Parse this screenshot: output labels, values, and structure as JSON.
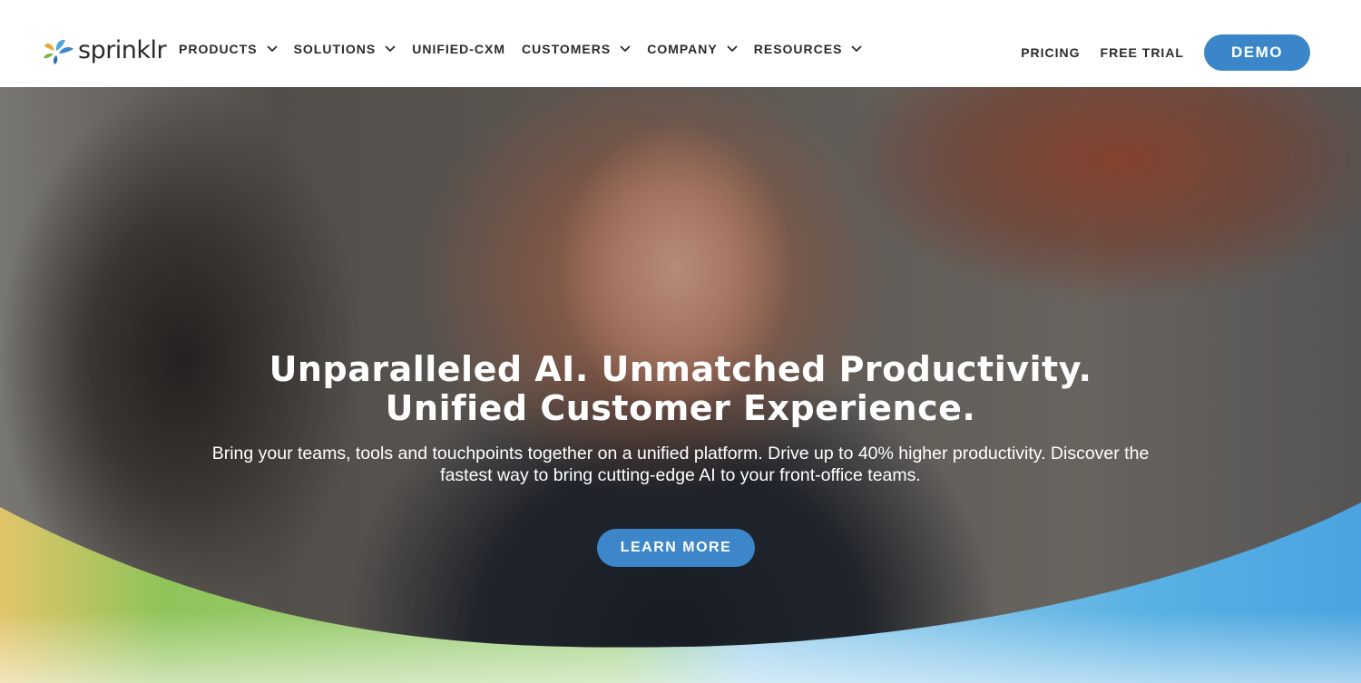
{
  "brand": {
    "name": "sprinklr",
    "accent": "#3b86c8"
  },
  "nav": {
    "items": [
      {
        "label": "PRODUCTS",
        "has_dropdown": true
      },
      {
        "label": "SOLUTIONS",
        "has_dropdown": true
      },
      {
        "label": "UNIFIED-CXM",
        "has_dropdown": false
      },
      {
        "label": "CUSTOMERS",
        "has_dropdown": true
      },
      {
        "label": "COMPANY",
        "has_dropdown": true
      },
      {
        "label": "RESOURCES",
        "has_dropdown": true
      }
    ],
    "right": {
      "pricing": "PRICING",
      "free_trial": "FREE TRIAL",
      "demo": "DEMO"
    }
  },
  "hero": {
    "headline_line1": "Unparalleled AI. Unmatched Productivity.",
    "headline_line2": "Unified Customer Experience.",
    "subtext": "Bring your teams, tools and touchpoints together on a unified platform. Drive up to 40% higher productivity. Discover the fastest way to bring cutting-edge AI to your front-office teams.",
    "cta": "LEARN MORE"
  }
}
